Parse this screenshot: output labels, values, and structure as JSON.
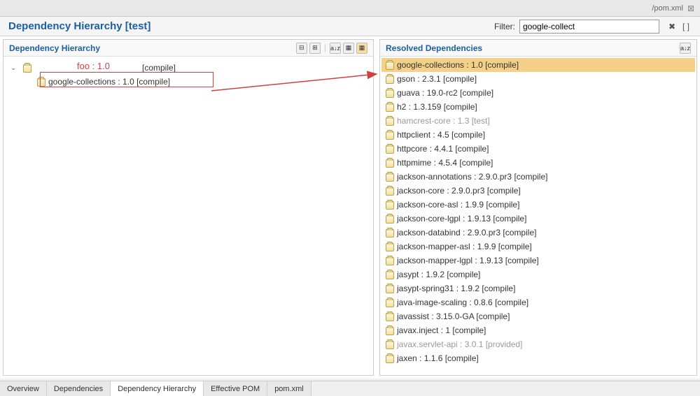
{
  "top_bar": {
    "file_path": "/pom.xml",
    "close_icon": "⊠"
  },
  "title": "Dependency Hierarchy [test]",
  "filter": {
    "label": "Filter:",
    "value": "google-collect"
  },
  "left_panel": {
    "title": "Dependency Hierarchy",
    "tree": {
      "root_label_annotation": "foo :  1.0",
      "root_scope": "[compile]",
      "child": "google-collections : 1.0 [compile]"
    }
  },
  "right_panel": {
    "title": "Resolved Dependencies",
    "items": [
      {
        "text": "google-collections : 1.0 [compile]",
        "selected": true,
        "grayed": false
      },
      {
        "text": "gson : 2.3.1 [compile]",
        "selected": false,
        "grayed": false
      },
      {
        "text": "guava : 19.0-rc2 [compile]",
        "selected": false,
        "grayed": false
      },
      {
        "text": "h2 : 1.3.159 [compile]",
        "selected": false,
        "grayed": false
      },
      {
        "text": "hamcrest-core : 1.3 [test]",
        "selected": false,
        "grayed": true
      },
      {
        "text": "httpclient : 4.5 [compile]",
        "selected": false,
        "grayed": false
      },
      {
        "text": "httpcore : 4.4.1 [compile]",
        "selected": false,
        "grayed": false
      },
      {
        "text": "httpmime : 4.5.4 [compile]",
        "selected": false,
        "grayed": false
      },
      {
        "text": "jackson-annotations : 2.9.0.pr3 [compile]",
        "selected": false,
        "grayed": false
      },
      {
        "text": "jackson-core : 2.9.0.pr3 [compile]",
        "selected": false,
        "grayed": false
      },
      {
        "text": "jackson-core-asl : 1.9.9 [compile]",
        "selected": false,
        "grayed": false
      },
      {
        "text": "jackson-core-lgpl : 1.9.13 [compile]",
        "selected": false,
        "grayed": false
      },
      {
        "text": "jackson-databind : 2.9.0.pr3 [compile]",
        "selected": false,
        "grayed": false
      },
      {
        "text": "jackson-mapper-asl : 1.9.9 [compile]",
        "selected": false,
        "grayed": false
      },
      {
        "text": "jackson-mapper-lgpl : 1.9.13 [compile]",
        "selected": false,
        "grayed": false
      },
      {
        "text": "jasypt : 1.9.2 [compile]",
        "selected": false,
        "grayed": false
      },
      {
        "text": "jasypt-spring31 : 1.9.2 [compile]",
        "selected": false,
        "grayed": false
      },
      {
        "text": "java-image-scaling : 0.8.6 [compile]",
        "selected": false,
        "grayed": false
      },
      {
        "text": "javassist : 3.15.0-GA [compile]",
        "selected": false,
        "grayed": false
      },
      {
        "text": "javax.inject : 1 [compile]",
        "selected": false,
        "grayed": false
      },
      {
        "text": "javax.servlet-api : 3.0.1 [provided]",
        "selected": false,
        "grayed": true
      },
      {
        "text": "jaxen : 1.1.6 [compile]",
        "selected": false,
        "grayed": false
      }
    ]
  },
  "bottom_tabs": {
    "items": [
      "Overview",
      "Dependencies",
      "Dependency Hierarchy",
      "Effective POM",
      "pom.xml"
    ],
    "active_index": 2
  },
  "toolbar_icons": {
    "collapse": "⊟",
    "expand": "⊞",
    "separator": "|",
    "sort": "a↓z",
    "nested": "▦",
    "sort2": "a↓z",
    "clear": "✖",
    "brackets": "[ ]"
  }
}
